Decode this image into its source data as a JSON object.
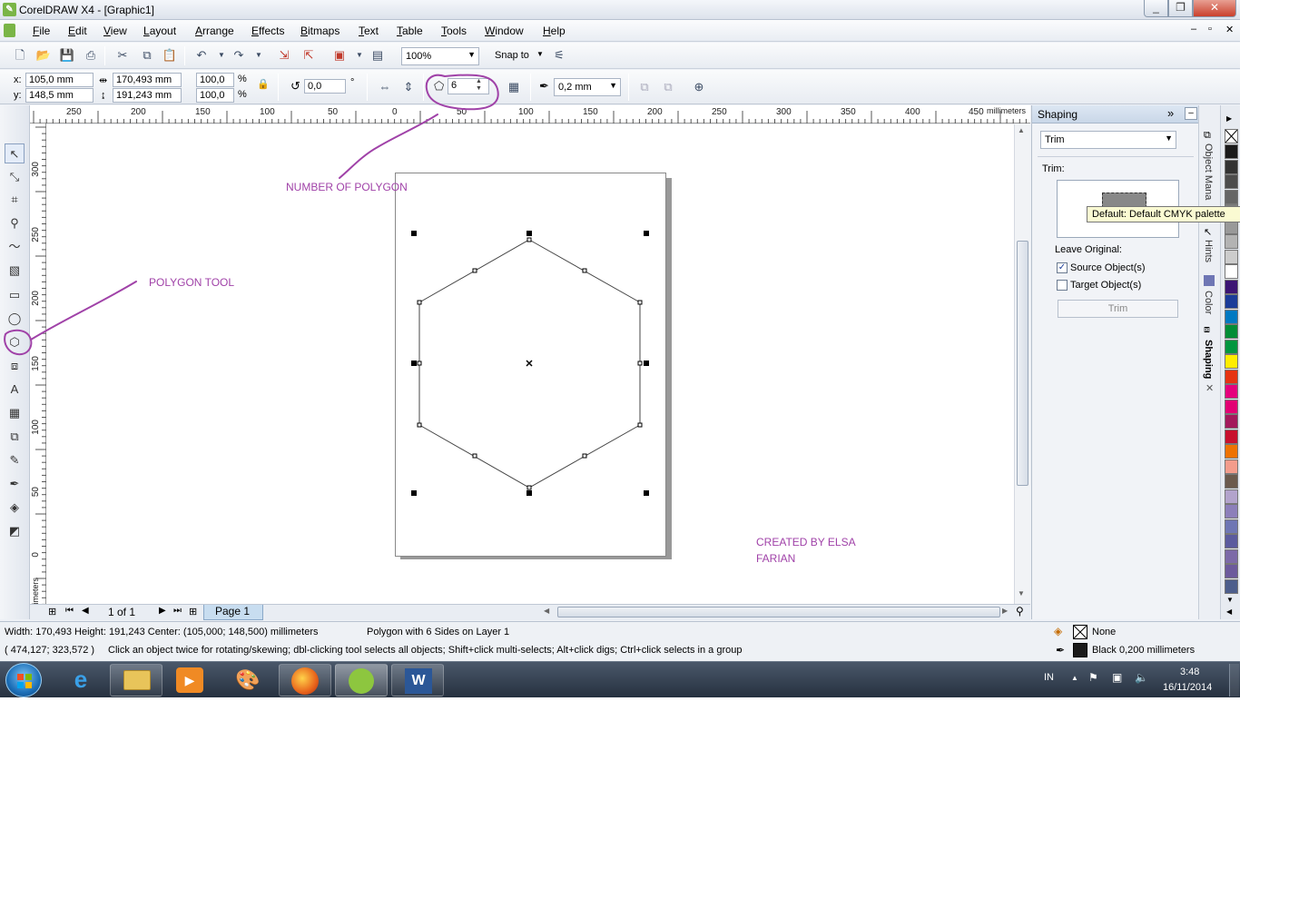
{
  "window": {
    "title": "CorelDRAW X4 - [Graphic1]",
    "min_label": "_",
    "max_label": "❐",
    "close_label": "✕"
  },
  "menu": [
    "File",
    "Edit",
    "View",
    "Layout",
    "Arrange",
    "Effects",
    "Bitmaps",
    "Text",
    "Table",
    "Tools",
    "Window",
    "Help"
  ],
  "doc_controls": {
    "min": "–",
    "restore": "▫",
    "close": "✕"
  },
  "standard_bar": {
    "zoom": "100%",
    "snap_to": "Snap to"
  },
  "property_bar": {
    "x_label": "x:",
    "x_value": "105,0 mm",
    "y_label": "y:",
    "y_value": "148,5 mm",
    "width_value": "170,493 mm",
    "height_value": "191,243 mm",
    "scale_x": "100,0",
    "scale_y": "100,0",
    "percent": "%",
    "rotation": "0,0",
    "degree": "°",
    "sides": "6",
    "outline_width": "0,2 mm"
  },
  "rulers": {
    "h_ticks": [
      "250",
      "200",
      "150",
      "100",
      "50",
      "0",
      "50",
      "100",
      "150",
      "200",
      "250",
      "300",
      "350",
      "400",
      "450"
    ],
    "h_unit": "millimeters",
    "v_ticks": [
      "300",
      "250",
      "200",
      "150",
      "100",
      "50",
      "0"
    ],
    "v_unit": "millimeters"
  },
  "annotations": {
    "number_of_polygon": "NUMBER OF POLYGON",
    "polygon_tool": "POLYGON TOOL",
    "created_by_line1": "CREATED BY ELSA",
    "created_by_line2": "FARIAN",
    "accent_color": "#a042a8"
  },
  "page_nav": {
    "page_count": "1 of 1",
    "page_tab": "Page 1"
  },
  "docker": {
    "title": "Shaping",
    "mode": "Trim",
    "trim_label": "Trim:",
    "tooltip": "Default: Default CMYK palette",
    "leave_original": "Leave Original:",
    "source_label": "Source Object(s)",
    "source_checked": true,
    "target_label": "Target Object(s)",
    "target_checked": false,
    "apply_button": "Trim",
    "tabs": [
      "Object Mana",
      "Hints",
      "Color",
      "Shaping"
    ]
  },
  "palette": [
    "#1a1a1a",
    "#333333",
    "#4d4d4d",
    "#666666",
    "#808080",
    "#999999",
    "#b3b3b3",
    "#cccccc",
    "#ffffff",
    "#3b1474",
    "#1a3c99",
    "#0079c2",
    "#008d36",
    "#009640",
    "#ffed00",
    "#e63312",
    "#e5007d",
    "#e20074",
    "#a3195b",
    "#c8102e",
    "#ee7203",
    "#f39c8c",
    "#6b5a4d",
    "#b2a3cc",
    "#8c7fba",
    "#6e76b4",
    "#5b5b9e",
    "#7c6aa8",
    "#6c5a9c",
    "#4d5e8c"
  ],
  "status": {
    "line1_dims": "Width: 170,493 Height: 191,243 Center: (105,000; 148,500) millimeters",
    "line1_object": "Polygon with 6 Sides on Layer 1",
    "line2_coords": "( 474,127; 323,572 )",
    "line2_hint": "Click an object twice for rotating/skewing; dbl-clicking tool selects all objects; Shift+click multi-selects; Alt+click digs; Ctrl+click selects in a group",
    "fill_label": "None",
    "outline_label": "Black  0,200 millimeters"
  },
  "taskbar": {
    "lang": "IN",
    "time": "3:48",
    "date": "16/11/2014"
  }
}
